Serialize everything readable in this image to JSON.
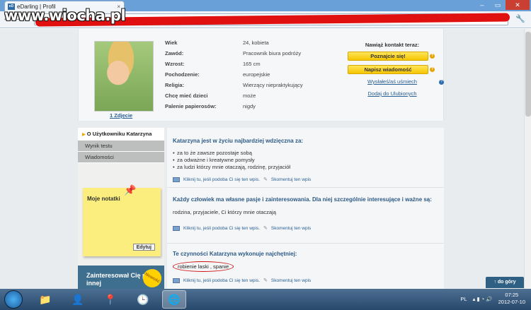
{
  "browser": {
    "tab_title": "eDarling | Profil",
    "tab_favicon": "eD",
    "tab_close": "×",
    "back": "←",
    "forward": "→",
    "watermark": "www.wiocha.pl",
    "win_min": "–",
    "win_max": "▭",
    "win_close": "✕",
    "wrench": "🔧"
  },
  "profile": {
    "photo_link": "1 Zdjęcie",
    "facts": [
      {
        "k": "Wiek",
        "v": "24, kobieta"
      },
      {
        "k": "Zawód:",
        "v": "Pracownik biura podróży"
      },
      {
        "k": "Wzrost:",
        "v": "165 cm"
      },
      {
        "k": "Pochodzenie:",
        "v": "europejskie"
      },
      {
        "k": "Religia:",
        "v": "Wierzący niepraktykujący"
      },
      {
        "k": "Chcę mieć dzieci",
        "v": "może"
      },
      {
        "k": "Palenie papierosów:",
        "v": "nigdy"
      }
    ],
    "contact": {
      "heading": "Nawiąż kontakt teraz:",
      "btn_meet": "Poznajcie się!",
      "btn_message": "Napisz wiadomość",
      "help": "?",
      "smile_link": "Wysłałeś/aś uśmiech",
      "fav_link": "Dodaj do Ulubionych"
    }
  },
  "sidebar": {
    "about": "O Użytkowniku Katarzyna",
    "about_arrow": "▶",
    "items": [
      "Wynik testu",
      "Wiadomości"
    ],
    "note_title": "Moje notatki",
    "note_edit": "Edytuj",
    "promo_text": "Zainteresował Cię profil innej",
    "promo_badge": "Nowość"
  },
  "content": {
    "s1_title": "Katarzyna jest w życiu najbardziej wdzięczna za:",
    "s1_items": [
      "za to że zawsze pozostaje sobą",
      "za odważne i kreatywne pomysły",
      "za ludzi którzy mnie otaczają, rodzinę, przyjaciół"
    ],
    "s2_title": "Każdy człowiek ma własne pasje i zainteresowania. Dla niej szczególnie interesujące i ważne są:",
    "s2_text": "rodzina, przyjaciele, Ci którzy mnie otaczają",
    "s3_title": "Te czynności Katarzyna wykonuje najchętniej:",
    "s3_text": "robienie laski , spanie",
    "like_text": "Kliknij tu, jeśli podoba Ci się ten wpis.",
    "comment_text": "Skomentuj ten wpis",
    "pen": "✎"
  },
  "page": {
    "to_top": "↑ do góry"
  },
  "taskbar": {
    "lang": "PL",
    "time": "07:25",
    "date": "2012-07-10"
  }
}
